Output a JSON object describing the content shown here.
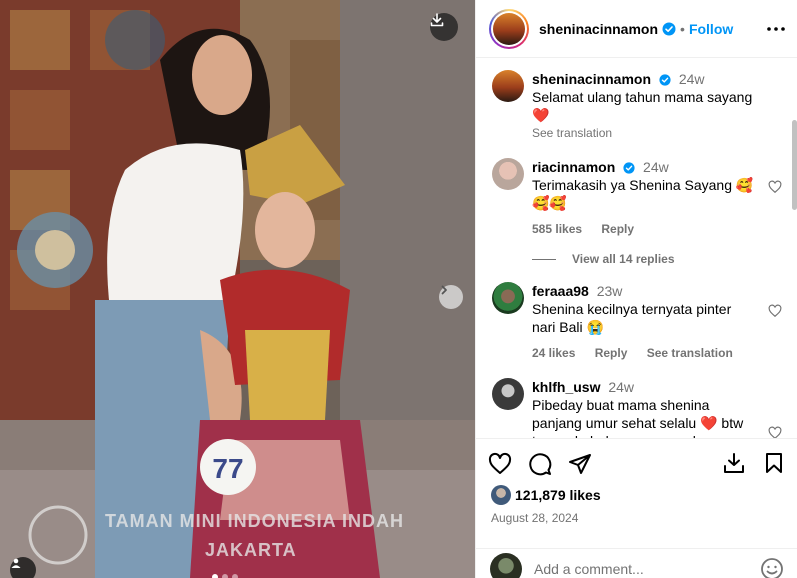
{
  "post": {
    "author": "sheninacinnamon",
    "follow_label": "Follow",
    "separator": "•",
    "likes": "121,879 likes",
    "date": "August 28, 2024",
    "photo_caption_text": "TAMAN MINI INDONESIA INDAH",
    "photo_caption_text2": "JAKARTA",
    "photo_badge_number": "77"
  },
  "comments": [
    {
      "user": "sheninacinnamon",
      "verified": true,
      "time": "24w",
      "text": "Selamat ulang tahun mama sayang ❤️",
      "see_translation": "See translation"
    },
    {
      "user": "riacinnamon",
      "verified": true,
      "time": "24w",
      "text": "Terimakasih ya Shenina Sayang 🥰🥰🥰",
      "likes": "585 likes",
      "reply": "Reply"
    },
    {
      "user": "feraaa98",
      "verified": false,
      "time": "23w",
      "text": "Shenina kecilnya ternyata pinter nari Bali 😭",
      "likes": "24 likes",
      "reply": "Reply",
      "see_translation": "See translation"
    },
    {
      "user": "khlfh_usw",
      "verified": false,
      "time": "24w",
      "text": "Pibeday buat mama shenina panjang umur sehat selalu ❤️ btw tanggal +bulan nya sama kya"
    }
  ],
  "view_replies": "View all 14 replies",
  "add_comment_placeholder": "Add a comment...",
  "colors": {
    "accent": "#0095f6",
    "secondary_text": "#737373",
    "heart": "#ff3040"
  },
  "icons": [
    "download-icon",
    "chevron-right-icon",
    "user-tag-icon",
    "verified-icon",
    "more-icon",
    "heart-icon",
    "comment-icon",
    "share-icon",
    "save-icon",
    "bookmark-icon",
    "emoji-icon"
  ]
}
